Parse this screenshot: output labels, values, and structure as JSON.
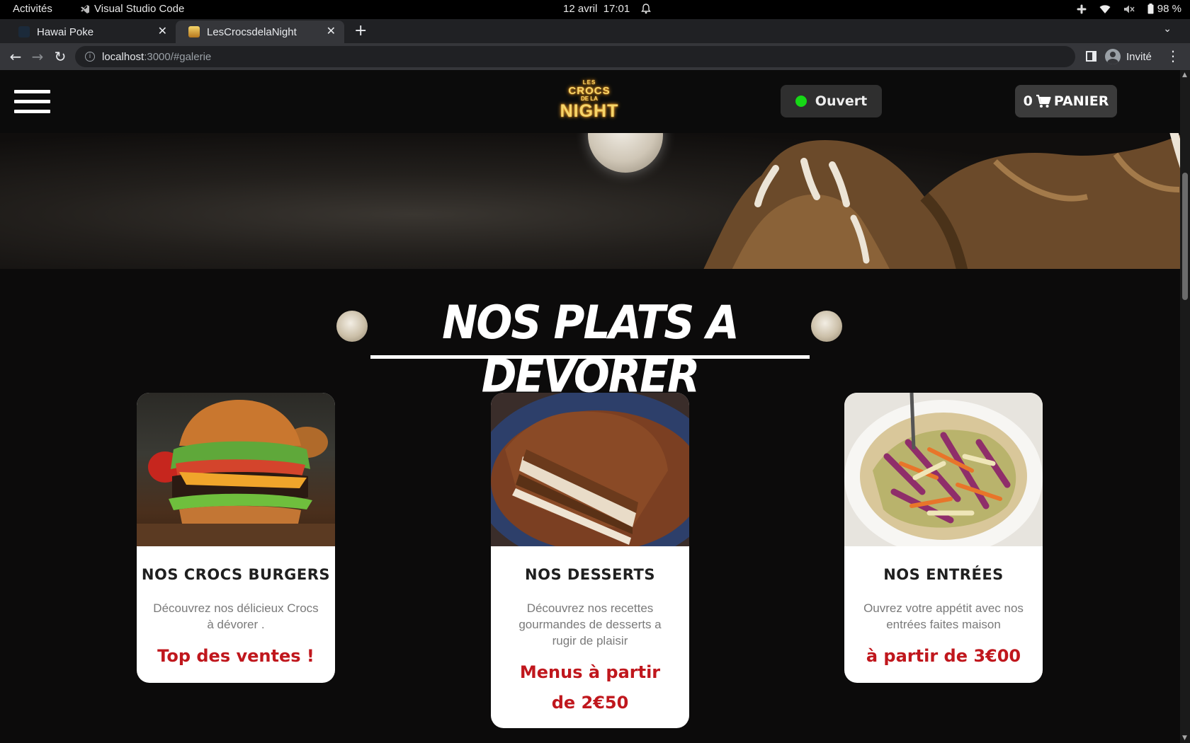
{
  "os": {
    "activities": "Activités",
    "app_name": "Visual Studio Code",
    "date": "12 avril",
    "time": "17:01",
    "battery": "98 %"
  },
  "browser": {
    "tabs": [
      {
        "label": "Hawai Poke"
      },
      {
        "label": "LesCrocsdelaNight"
      }
    ],
    "url_host": "localhost",
    "url_rest": ":3000/#galerie",
    "profile_label": "Invité"
  },
  "header": {
    "logo": {
      "line1": "LES",
      "line2": "CROCS",
      "line3": "DE LA",
      "line4": "NIGHT"
    },
    "status_label": "Ouvert",
    "status_color": "#16d816",
    "cart_count": "0",
    "cart_label": "PANIER"
  },
  "gallery": {
    "title": "NOS PLATS A DEVORER",
    "cards": [
      {
        "title": "NOS CROCS BURGERS",
        "description": "Découvrez nos délicieux Crocs à dévorer .",
        "highlight": "Top des ventes !"
      },
      {
        "title": "NOS DESSERTS",
        "description": "Découvrez nos recettes gourmandes de desserts a rugir de plaisir",
        "highlight": "Menus à partir de 2€50"
      },
      {
        "title": "NOS ENTRÉES",
        "description": "Ouvrez votre appétit avec nos entrées faites maison",
        "highlight": "à partir de 3€00"
      }
    ]
  },
  "colors": {
    "accent_red": "#c0171d",
    "page_bg": "#0c0b0b"
  }
}
